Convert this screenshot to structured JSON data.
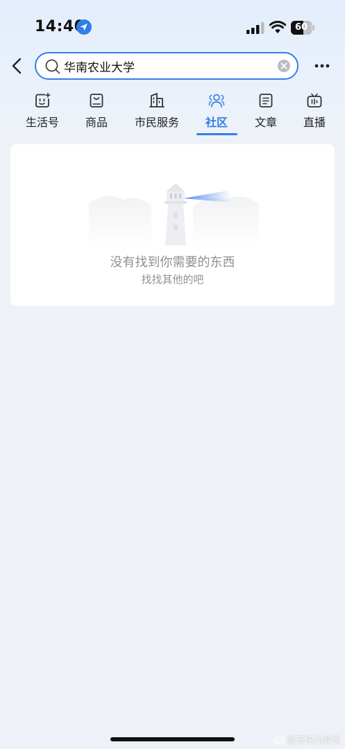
{
  "status_bar": {
    "time": "14:40",
    "battery_level": "60",
    "battery_fraction": 0.6,
    "icons": [
      "location-arrow-icon",
      "signal-bars-icon",
      "wifi-icon",
      "battery-icon"
    ]
  },
  "search": {
    "query": "华南农业大学",
    "placeholder": ""
  },
  "tabs": [
    {
      "label": "生活号",
      "icon": "life-account-icon",
      "active": false
    },
    {
      "label": "商品",
      "icon": "shopping-bag-icon",
      "active": false
    },
    {
      "label": "市民服务",
      "icon": "city-building-icon",
      "active": false
    },
    {
      "label": "社区",
      "icon": "community-people-icon",
      "active": true
    },
    {
      "label": "文章",
      "icon": "article-icon",
      "active": false
    },
    {
      "label": "直播",
      "icon": "live-tv-icon",
      "active": false
    }
  ],
  "empty_state": {
    "title": "没有找到你需要的东西",
    "subtitle": "找找其他的吧",
    "illustration": "lighthouse-icon"
  },
  "watermark": {
    "text": "@方块儿会长",
    "icon": "weibo-icon"
  },
  "colors": {
    "accent": "#2f7ee8",
    "background": "#eef2f8",
    "muted_text": "#8e9196"
  }
}
